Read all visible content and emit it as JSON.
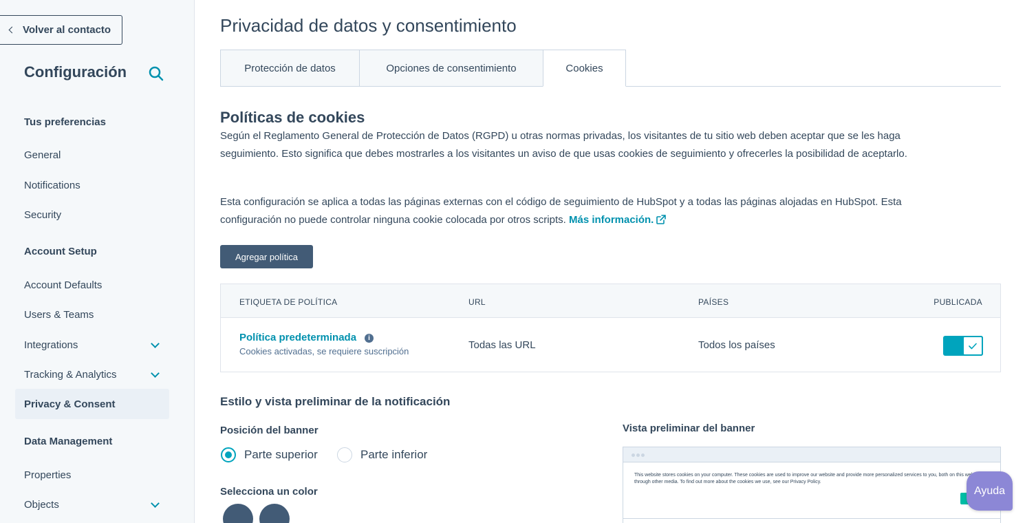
{
  "sidebar": {
    "back_label": "Volver al contacto",
    "title": "Configuración",
    "items": [
      {
        "label": "Tus preferencias"
      },
      {
        "label": "General"
      },
      {
        "label": "Notifications"
      },
      {
        "label": "Security"
      },
      {
        "label": "Account Setup"
      },
      {
        "label": "Account Defaults"
      },
      {
        "label": "Users & Teams"
      },
      {
        "label": "Integrations"
      },
      {
        "label": "Tracking & Analytics"
      },
      {
        "label": "Privacy & Consent"
      },
      {
        "label": "Data Management"
      },
      {
        "label": "Properties"
      },
      {
        "label": "Objects"
      }
    ]
  },
  "main": {
    "title": "Privacidad de datos y consentimiento",
    "tabs": [
      {
        "label": "Protección de datos"
      },
      {
        "label": "Opciones de consentimiento"
      },
      {
        "label": "Cookies"
      }
    ],
    "section_title": "Políticas de cookies",
    "para1": "Según el Reglamento General de Protección de Datos (RGPD) u otras normas privadas, los visitantes de tu sitio web deben aceptar que se les haga seguimiento. Esto significa que debes mostrarles a los visitantes un aviso de que usas cookies de seguimiento y ofrecerles la posibilidad de aceptarlo.",
    "para2": "Esta configuración se aplica a todas las páginas externas con el código de seguimiento de HubSpot y a todas las páginas alojadas en HubSpot. Esta configuración no puede controlar ninguna cookie colocada por otros scripts.",
    "more_info": "Más información.",
    "add_policy": "Agregar política",
    "table": {
      "headers": [
        "ETIQUETA DE POLÍTICA",
        "URL",
        "PAÍSES",
        "PUBLICADA"
      ],
      "row": {
        "name": "Política predeterminada",
        "sub": "Cookies activadas, se requiere suscripción",
        "url": "Todas las URL",
        "countries": "Todos los países",
        "published": true
      }
    },
    "notif_title": "Estilo y vista preliminar de la notificación",
    "banner_position_label": "Posición del banner",
    "position_options": [
      "Parte superior",
      "Parte inferior"
    ],
    "selected_position": "Parte superior",
    "color_label": "Selecciona un color",
    "preview_label": "Vista preliminar del banner",
    "preview_text": "This website stores cookies on your computer. These cookies are used to improve our website and provide more personalized services to you, both on this website and through other media. To find out more about the cookies we use, see our Privacy Policy."
  },
  "help": "Ayuda",
  "colors": {
    "accent": "#00a4bd",
    "link": "#0091ae",
    "text": "#33475b",
    "button": "#425b76",
    "help": "#8c87d6"
  }
}
